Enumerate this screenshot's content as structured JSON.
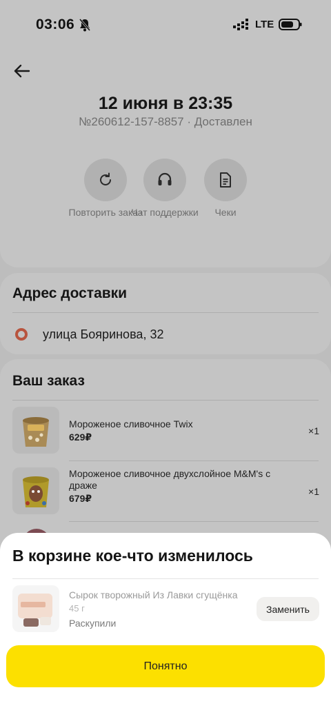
{
  "status_bar": {
    "time": "03:06",
    "network": "LTE",
    "icons": [
      "bell-muted-icon",
      "signal-icon",
      "battery-icon"
    ]
  },
  "header": {
    "date": "12 июня в 23:35",
    "meta": "№260612-157-8857 · Доставлен",
    "actions": [
      {
        "label": "Повторить заказ",
        "icon": "refresh-icon"
      },
      {
        "label": "Чат поддержки",
        "icon": "headset-icon"
      },
      {
        "label": "Чеки",
        "icon": "receipt-icon"
      }
    ]
  },
  "address": {
    "title": "Адрес доставки",
    "text": "улица Бояринова, 32"
  },
  "order": {
    "title": "Ваш заказ",
    "items": [
      {
        "name": "Мороженое сливочное Twix",
        "price": "629₽",
        "qty": "×1"
      },
      {
        "name": "Мороженое сливочное двухслойное M&M's с драже",
        "price": "679₽",
        "qty": "×1"
      }
    ]
  },
  "sheet": {
    "title": "В корзине кое-что изменилось",
    "item": {
      "name": "Сырок творожный Из Лавки сгущёнка",
      "weight": "45 г",
      "status": "Раскупили"
    },
    "replace_label": "Заменить",
    "confirm_label": "Понятно"
  },
  "colors": {
    "accent": "#fce000",
    "sheet_bg": "#ffffff",
    "overlay_bg": "#c4c4c4",
    "pin": "#b8543e"
  }
}
